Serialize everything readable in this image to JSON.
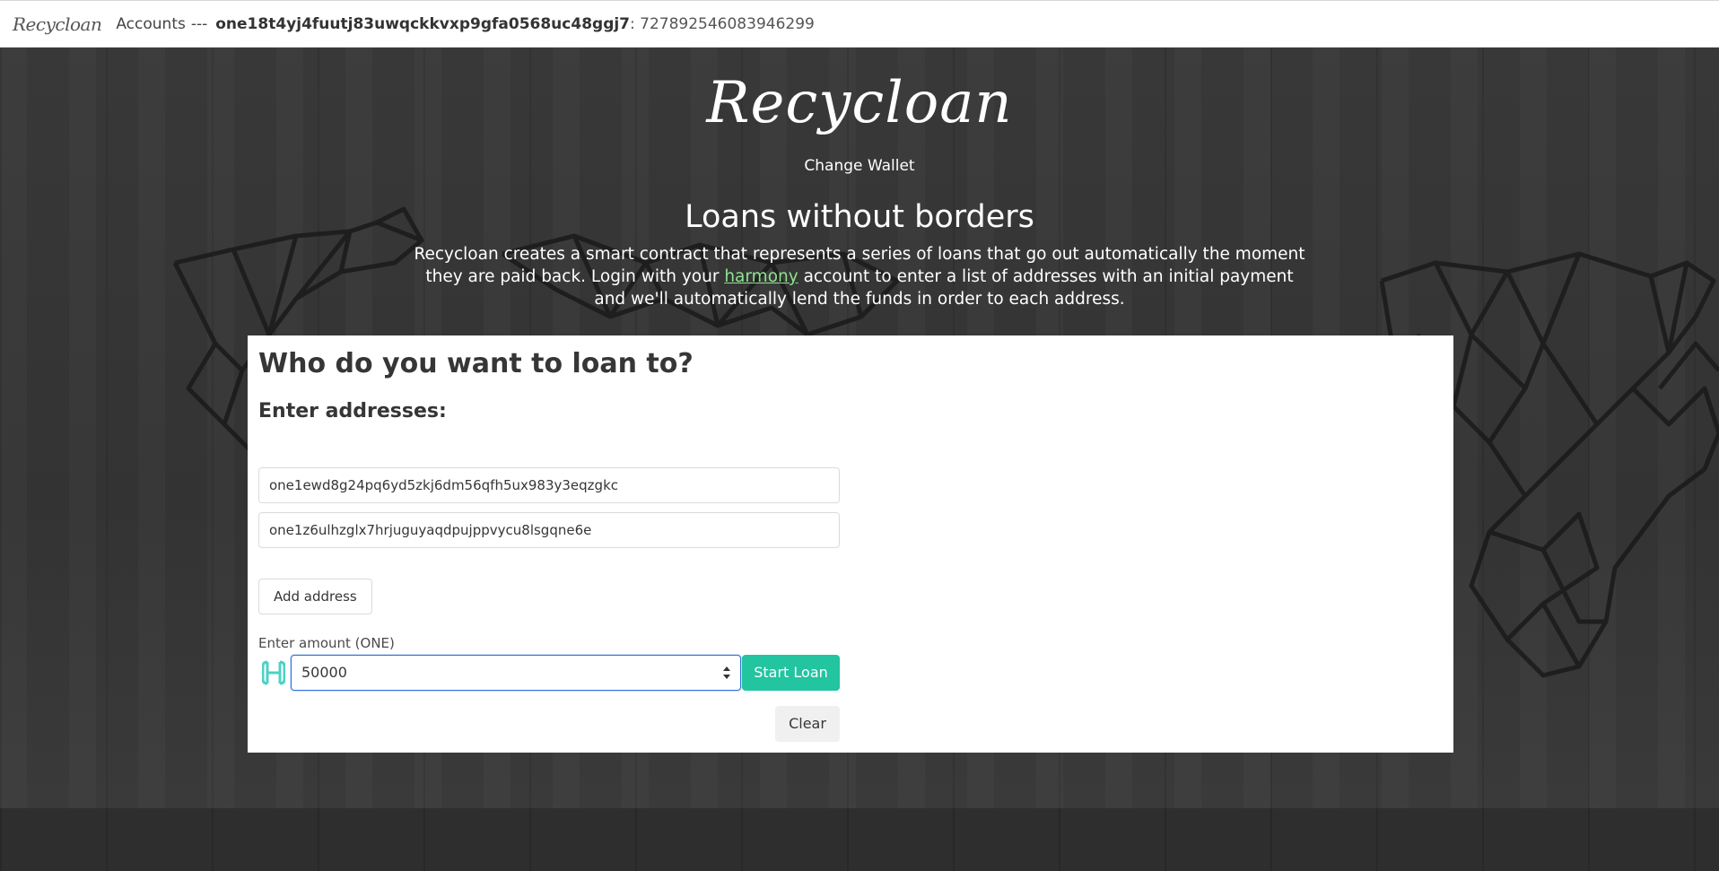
{
  "nav": {
    "brand": "Recycloan",
    "accounts_label": "Accounts",
    "separator": "---",
    "account_address": "one18t4yj4fuutj83uwqckkvxp9gfa0568uc48ggj7",
    "account_balance": ": 727892546083946299"
  },
  "hero": {
    "logo": "Recycloan",
    "change_wallet": "Change Wallet",
    "title": "Loans without borders",
    "text_before_link": "Recycloan creates a smart contract that represents a series of loans that go out automatically the moment they are paid back. Login with your ",
    "link_text": "harmony",
    "text_after_link": " account to enter a list of addresses with an initial payment and we'll automatically lend the funds in order to each address."
  },
  "form": {
    "title": "Who do you want to loan to?",
    "subtitle": "Enter addresses:",
    "addresses": [
      "one1ewd8g24pq6yd5zkj6dm56qfh5ux983y3eqzgkc",
      "one1z6ulhzglx7hrjuguyaqdpujppvycu8lsgqne6e"
    ],
    "add_address_label": "Add address",
    "amount_label": "Enter amount (ONE)",
    "amount_value": "50000",
    "start_loan_label": "Start Loan",
    "clear_label": "Clear"
  },
  "colors": {
    "accent": "#23c4a0",
    "link": "#8fe38f",
    "focus": "#3273dc"
  },
  "icons": {
    "amount_prefix": "harmony-logo-icon"
  }
}
